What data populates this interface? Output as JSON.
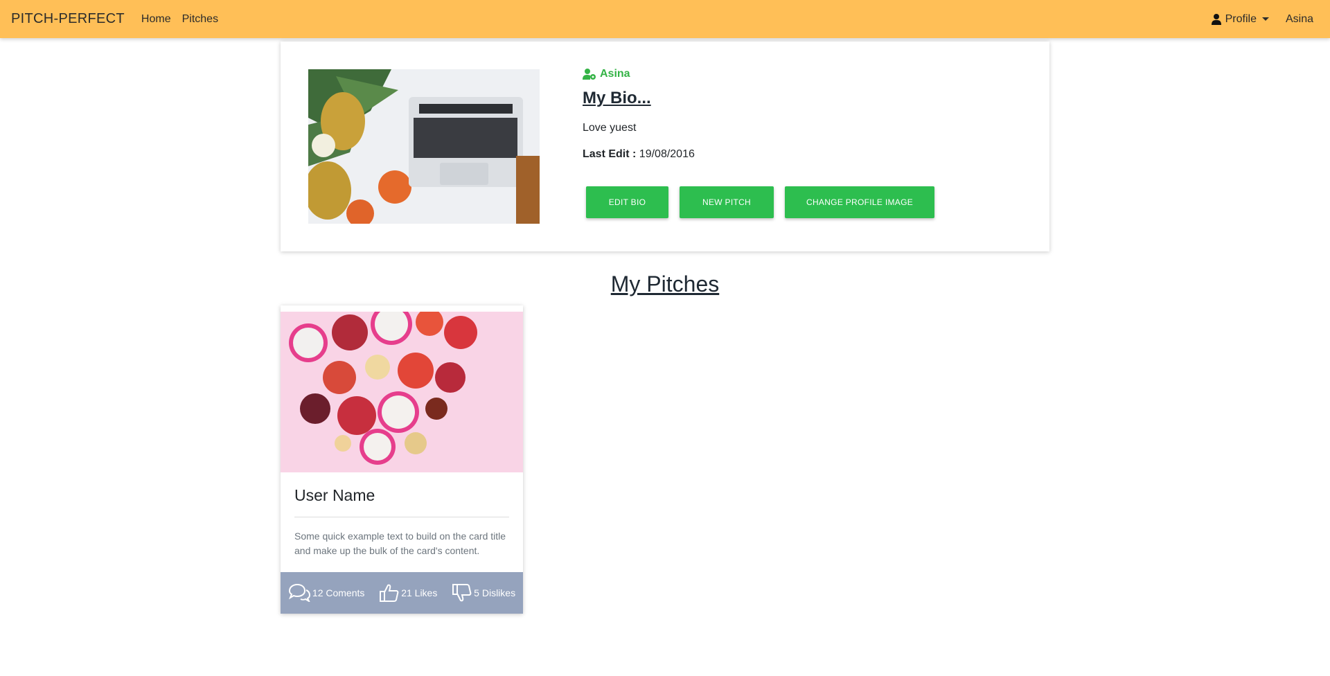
{
  "navbar": {
    "brand": "PITCH-PERFECT",
    "links": [
      "Home",
      "Pitches"
    ],
    "profile_label": "Profile",
    "username": "Asina",
    "bg_color": "#ffbf57"
  },
  "profile": {
    "username": "Asina",
    "bio_title": "My Bio...",
    "bio_text": "Love yuest",
    "last_edit_label": "Last Edit :",
    "last_edit_value": "19/08/2016",
    "buttons": {
      "edit_bio": "EDIT BIO",
      "new_pitch": "NEW PITCH",
      "change_image": "CHANGE PROFILE IMAGE"
    },
    "accent_color": "#2dbe4f"
  },
  "pitches": {
    "heading": "My Pitches",
    "cards": [
      {
        "title": "User Name",
        "text": "Some quick example text to build on the card title and make up the bulk of the card's content.",
        "comments": "12 Coments",
        "likes": "21 Likes",
        "dislikes": "5 Dislikes"
      }
    ]
  },
  "icons": {
    "profile": "user-icon",
    "user_settings": "user-gear-icon",
    "comments": "comments-icon",
    "likes": "thumbs-up-icon",
    "dislikes": "thumbs-down-icon"
  }
}
